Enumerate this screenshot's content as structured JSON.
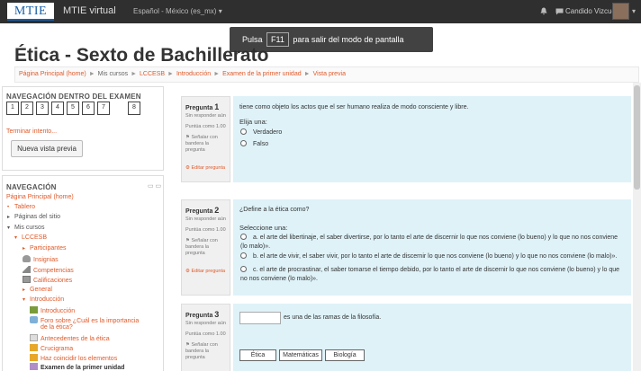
{
  "topbar": {
    "logo": "MTIE",
    "site_name": "MTIE virtual",
    "language": "Español - México (es_mx) ▾",
    "icons": [
      "bell-icon",
      "chat-icon"
    ],
    "user_name": "Candido Vizcuett",
    "user_menu": "▾"
  },
  "fullscreen_notice": {
    "prefix": "Pulsa",
    "key": "F11",
    "suffix": "para salir del modo de pantalla completa"
  },
  "page_title": "Ética - Sexto de Bachillerato",
  "breadcrumb": [
    {
      "label": "Página Principal (home)"
    },
    {
      "label": "Mis cursos"
    },
    {
      "label": "LCCESB"
    },
    {
      "label": "Introducción"
    },
    {
      "label": "Examen de la primer unidad"
    },
    {
      "label": "Vista previa"
    }
  ],
  "quiz_nav": {
    "title": "NAVEGACIÓN DENTRO DEL EXAMEN",
    "questions": [
      "1",
      "2",
      "3",
      "4",
      "5",
      "6",
      "7",
      "8"
    ],
    "finish_link": "Terminar intento...",
    "new_preview_button": "Nueva vista previa"
  },
  "site_nav": {
    "title": "NAVEGACIÓN",
    "controls": "▭ ▭",
    "items": [
      {
        "label": "Página Principal (home)",
        "style": "link",
        "glyph": "",
        "icon": ""
      },
      {
        "label": "Tablero",
        "style": "link",
        "glyph": "•",
        "icon": ""
      },
      {
        "label": "Páginas del sitio",
        "style": "plain",
        "glyph": "▸",
        "icon": ""
      },
      {
        "label": "Mis cursos",
        "style": "plain",
        "glyph": "▾",
        "icon": ""
      },
      {
        "label": "LCCESB",
        "style": "link",
        "glyph": "▾",
        "icon": ""
      },
      {
        "label": "Participantes",
        "style": "link",
        "glyph": "▸",
        "icon": ""
      },
      {
        "label": "Insignias",
        "style": "link",
        "glyph": "",
        "icon": "badge-icon"
      },
      {
        "label": "Competencias",
        "style": "link",
        "glyph": "",
        "icon": "competencies-icon"
      },
      {
        "label": "Calificaciones",
        "style": "link",
        "glyph": "",
        "icon": "grades-icon"
      },
      {
        "label": "General",
        "style": "link",
        "glyph": "▸",
        "icon": ""
      },
      {
        "label": "Introducción",
        "style": "link",
        "glyph": "▾",
        "icon": ""
      },
      {
        "label": "Introducción",
        "style": "link",
        "glyph": "",
        "icon": "page-icon"
      },
      {
        "label": "Foro sobre ¿Cuál es la importancia",
        "style": "link",
        "glyph": "",
        "icon": "forum-icon"
      },
      {
        "label": "de la ética?",
        "style": "link",
        "glyph": "",
        "icon": ""
      },
      {
        "label": "Antecedentes de la ética",
        "style": "link",
        "glyph": "",
        "icon": "file-icon"
      },
      {
        "label": "Crucigrama",
        "style": "link",
        "glyph": "",
        "icon": "crossword-icon"
      },
      {
        "label": "Haz coincidir los elementos",
        "style": "link",
        "glyph": "",
        "icon": "match-icon"
      },
      {
        "label": "Examen de la primer unidad",
        "style": "bold",
        "glyph": "",
        "icon": "quiz-icon"
      }
    ]
  },
  "question_meta": {
    "label": "Pregunta",
    "status": "Sin responder aún",
    "score": "Puntúa como 1.00",
    "flag": "Señalar con bandera la pregunta",
    "edit": "Editar pregunta"
  },
  "questions": [
    {
      "number": "1",
      "text": "tiene como objeto los actos que el ser humano realiza de modo consciente y libre.",
      "prompt": "Elija una:",
      "options": [
        "Verdadero",
        "Falso"
      ]
    },
    {
      "number": "2",
      "text": "¿Define a la ética como?",
      "prompt": "Seleccione una:",
      "options": [
        "a. el arte del libertinaje, el saber divertirse, por lo tanto el arte de discernir lo que nos conviene (lo bueno) y lo que no nos conviene (lo malo)».",
        "b. el arte de vivir, el saber vivir, por lo tanto el arte de discernir lo que nos conviene (lo bueno) y lo que no nos conviene (lo malo)».",
        "c. el arte de procrastinar, el saber tomarse el tiempo debido, por lo tanto el arte de discernir lo que nos conviene (lo bueno) y lo que no nos conviene (lo malo)»."
      ]
    },
    {
      "number": "3",
      "text": "es una de las ramas de la filosofía.",
      "choices": [
        "Ética",
        "Matemáticas",
        "Biología"
      ]
    }
  ],
  "colors": {
    "accent": "#e05a2a",
    "topbar": "#2f2f2f",
    "question_bg": "#def2f8",
    "info_bg": "#f0f0f0"
  }
}
